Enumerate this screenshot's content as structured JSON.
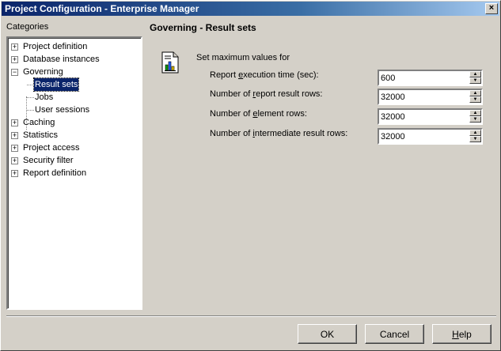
{
  "window": {
    "title": "Project Configuration - Enterprise Manager",
    "close_glyph": "×"
  },
  "categories_label": "Categories",
  "tree": [
    {
      "label": "Project definition",
      "expander": "+"
    },
    {
      "label": "Database instances",
      "expander": "+"
    },
    {
      "label": "Governing",
      "expander": "−"
    },
    {
      "label": "Result sets",
      "expander": ""
    },
    {
      "label": "Jobs",
      "expander": ""
    },
    {
      "label": "User sessions",
      "expander": ""
    },
    {
      "label": "Caching",
      "expander": "+"
    },
    {
      "label": "Statistics",
      "expander": "+"
    },
    {
      "label": "Project access",
      "expander": "+"
    },
    {
      "label": "Security filter",
      "expander": "+"
    },
    {
      "label": "Report definition",
      "expander": "+"
    }
  ],
  "panel": {
    "heading": "Governing - Result sets",
    "group_label": "Set maximum values for",
    "fields": [
      {
        "pre": "Report ",
        "u": "e",
        "post": "xecution time (sec):",
        "value": "600"
      },
      {
        "pre": "Number of ",
        "u": "r",
        "post": "eport result rows:",
        "value": "32000"
      },
      {
        "pre": "Number of ",
        "u": "e",
        "post": "lement rows:",
        "value": "32000"
      },
      {
        "pre": "Number of ",
        "u": "i",
        "post": "ntermediate result rows:",
        "value": "32000"
      }
    ]
  },
  "buttons": {
    "ok": "OK",
    "cancel": "Cancel",
    "help_u": "H",
    "help_rest": "elp"
  },
  "colors": {
    "title_start": "#0a246a",
    "title_end": "#a6caf0",
    "selection": "#0a246a",
    "face": "#d4d0c8"
  }
}
